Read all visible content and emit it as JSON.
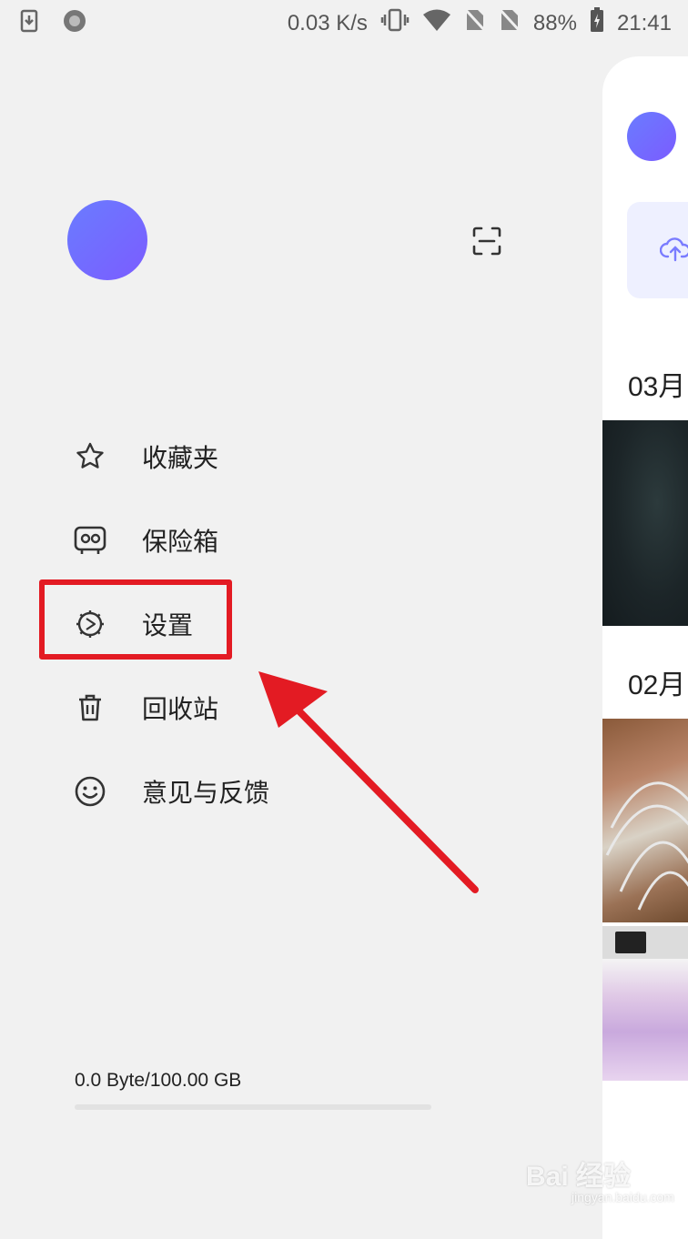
{
  "status_bar": {
    "net_speed": "0.03 K/s",
    "battery": "88%",
    "time": "21:41",
    "icons": [
      "download-icon",
      "record-icon",
      "vibrate-icon",
      "wifi-icon",
      "no-sim-icon",
      "no-sim-icon",
      "battery-charging-icon"
    ]
  },
  "drawer": {
    "menu": [
      {
        "label": "收藏夹",
        "icon": "star-icon"
      },
      {
        "label": "保险箱",
        "icon": "safe-icon"
      },
      {
        "label": "设置",
        "icon": "settings-icon"
      },
      {
        "label": "回收站",
        "icon": "trash-icon"
      },
      {
        "label": "意见与反馈",
        "icon": "smile-icon"
      }
    ],
    "storage": {
      "text": "0.0 Byte/100.00 GB",
      "used_fraction": 0
    }
  },
  "panel": {
    "dates": [
      "03月",
      "02月"
    ]
  },
  "watermark": {
    "text": "Bai 经验",
    "sub": "jingyan.baidu.com"
  },
  "colors": {
    "accent": "#6a6cff",
    "highlight": "#e31b23",
    "background": "#f1f1f1"
  }
}
